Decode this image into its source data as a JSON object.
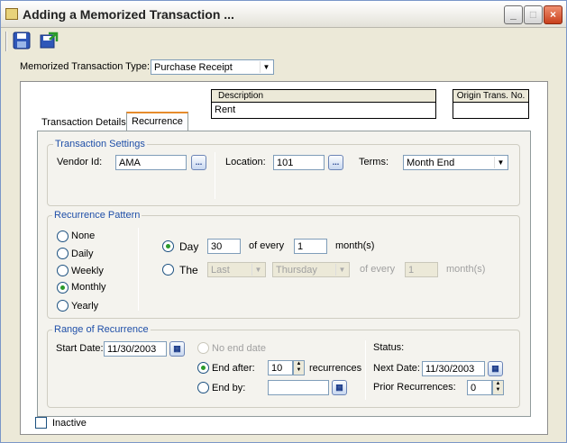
{
  "window": {
    "title": "Adding a Memorized Transaction ..."
  },
  "window_controls": {
    "minimize": "_",
    "maximize": "□",
    "close": "×"
  },
  "toolbar": {
    "save_icon": "save-icon",
    "save_close_icon": "save-close-icon"
  },
  "memorized_type": {
    "label": "Memorized Transaction Type:",
    "value": "Purchase Receipt"
  },
  "header": {
    "description_label": "Description",
    "description_value": "Rent",
    "origin_label": "Origin Trans. No.",
    "origin_value": ""
  },
  "tabs": [
    {
      "label": "Transaction Details",
      "active": false
    },
    {
      "label": "Recurrence",
      "active": true
    }
  ],
  "transaction_settings": {
    "title": "Transaction Settings",
    "vendor_label": "Vendor Id:",
    "vendor_value": "AMA",
    "location_label": "Location:",
    "location_value": "101",
    "terms_label": "Terms:",
    "terms_value": "Month End",
    "ellipsis": "..."
  },
  "recurrence_pattern": {
    "title": "Recurrence Pattern",
    "options": [
      "None",
      "Daily",
      "Weekly",
      "Monthly",
      "Yearly"
    ],
    "selected": "Monthly",
    "day_label": "Day",
    "day_value": "30",
    "of_every": "of every",
    "every_value": "1",
    "months": "month(s)",
    "the_label": "The",
    "the_which": "Last",
    "the_weekday": "Thursday",
    "the_every_value": "1"
  },
  "range": {
    "title": "Range of Recurrence",
    "start_label": "Start Date:",
    "start_value": "11/30/2003",
    "no_end": "No end date",
    "end_after": "End after:",
    "end_after_value": "10",
    "recurrences": "recurrences",
    "end_by": "End by:",
    "end_by_value": "",
    "status_label": "Status:",
    "next_label": "Next Date:",
    "next_value": "11/30/2003",
    "prior_label": "Prior Recurrences:",
    "prior_value": "0"
  },
  "inactive": {
    "label": "Inactive",
    "checked": false
  },
  "colors": {
    "group_title": "#1f4fa8",
    "tab_accent": "#e68b2c",
    "window_bg": "#ece9d8"
  }
}
